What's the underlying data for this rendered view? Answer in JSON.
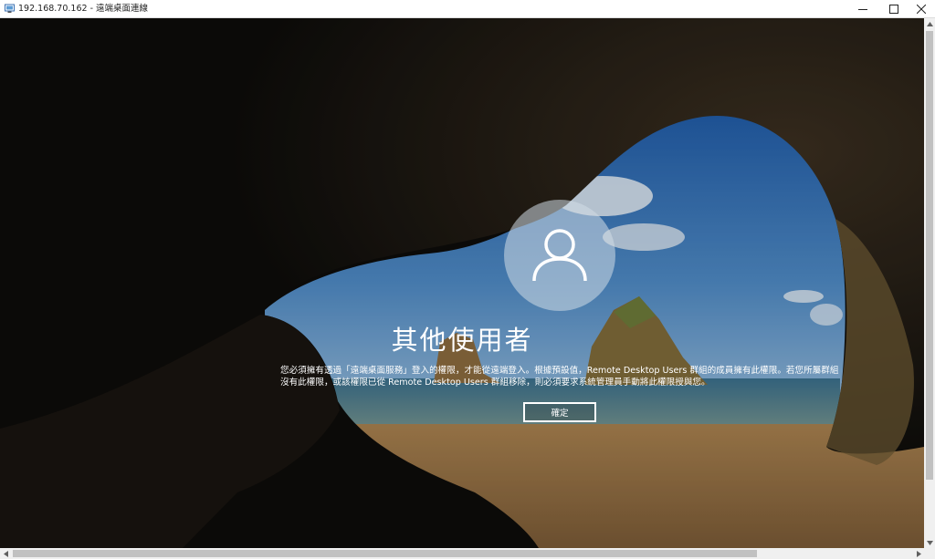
{
  "window": {
    "title": "192.168.70.162 - 遠端桌面連線"
  },
  "lockscreen": {
    "user_name": "其他使用者",
    "message": "您必須擁有透過「遠端桌面服務」登入的權限，才能從遠端登入。根據預設值，Remote Desktop Users 群組的成員擁有此權限。若您所屬群組沒有此權限，或該權限已從 Remote Desktop Users 群組移除，則必須要求系統管理員手動將此權限授與您。",
    "ok_label": "確定",
    "avatar_icon": "user-icon"
  },
  "colors": {
    "sky": "#3d78b8",
    "sand": "#b58a57",
    "cave": "#0d0c0a",
    "text": "#ffffff"
  }
}
